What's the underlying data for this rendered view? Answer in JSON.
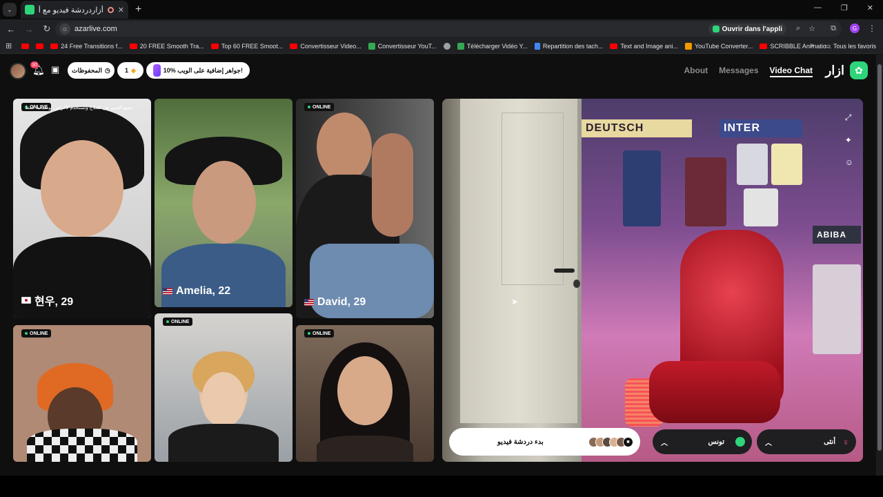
{
  "browser": {
    "tab_title": "أزاردردشة فيديو مع أشخاص",
    "url": "azarlive.com",
    "open_app": "Ouvrir dans l'appli",
    "profile_initial": "G",
    "bookmarks": [
      {
        "label": "24 Free Transitions f...",
        "icon": "youtube-icon"
      },
      {
        "label": "20 FREE Smooth Tra...",
        "icon": "youtube-icon"
      },
      {
        "label": "Top 60 FREE Smoot...",
        "icon": "youtube-icon"
      },
      {
        "label": "Convertisseur Video...",
        "icon": "youtube-icon"
      },
      {
        "label": "Convertisseur YouT...",
        "icon": "converter-icon"
      },
      {
        "label": "Télécharger Vidéo Y...",
        "icon": "download-icon"
      },
      {
        "label": "Repartition des tach...",
        "icon": "docs-icon"
      },
      {
        "label": "Text and Image ani...",
        "icon": "youtube-icon"
      },
      {
        "label": "YouTube Converter...",
        "icon": "converter-icon"
      },
      {
        "label": "SCRIBBLE Animatio...",
        "icon": "youtube-icon"
      }
    ],
    "all_bookmarks": "Tous les favoris"
  },
  "header": {
    "notif_count": "30",
    "saved_label": "المحفوظات",
    "gems_count": "1",
    "promo_label": "10% جواهر إضافية على الويب!",
    "nav": [
      "About",
      "Messages",
      "Video Chat"
    ],
    "logo_text": "ازار"
  },
  "cards": [
    {
      "status": "ONLINE",
      "caption": "현우, 29",
      "flag": "kr",
      "overlay": "جميع الصور هي للعلاج وتستخدم لأغراض توضيحية فقط"
    },
    {
      "status": "",
      "caption": "Amelia, 22",
      "flag": "us"
    },
    {
      "status": "ONLINE",
      "caption": "David, 29",
      "flag": "us"
    },
    {
      "status": "ONLINE",
      "caption": "",
      "flag": ""
    },
    {
      "status": "ONLINE",
      "caption": "",
      "flag": ""
    },
    {
      "status": "ONLINE",
      "caption": "",
      "flag": ""
    }
  ],
  "video": {
    "banners": [
      "DEUTSCH",
      "INTER",
      "ABIBA"
    ],
    "start_label": "بدء دردشة فيديو",
    "country_label": "تونس",
    "gender_label": "أنثى"
  },
  "colors": {
    "accent": "#2ed47a",
    "page_bg": "#0f0f10",
    "badge": "#ff3b5c"
  }
}
